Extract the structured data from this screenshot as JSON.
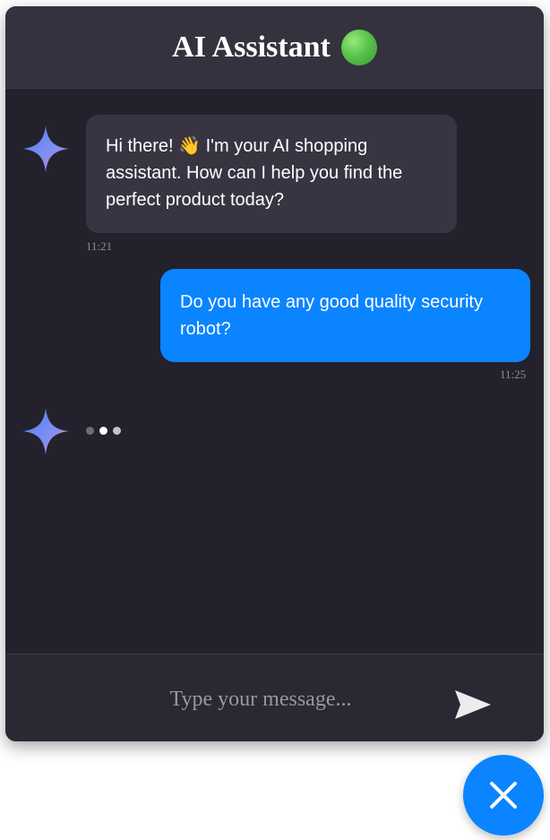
{
  "header": {
    "title": "AI Assistant",
    "status_icon": "green-circle-icon",
    "status_color": "#58c34a"
  },
  "messages": [
    {
      "sender": "assistant",
      "avatar_icon": "sparkle-icon",
      "text": "Hi there! 👋 I'm your AI shopping assistant. How can I help you find the perfect product today?",
      "time": "11:21"
    },
    {
      "sender": "user",
      "text": "Do you have any good quality security robot?",
      "time": "11:25"
    }
  ],
  "typing_indicator": {
    "avatar_icon": "sparkle-icon",
    "dots": 3
  },
  "input": {
    "placeholder": "Type your message...",
    "value": ""
  },
  "send_icon": "send-icon",
  "close_icon": "close-icon",
  "colors": {
    "accent": "#0a84ff",
    "window_bg": "#23212b",
    "header_bg": "#35313f",
    "bot_bubble": "#383442"
  }
}
